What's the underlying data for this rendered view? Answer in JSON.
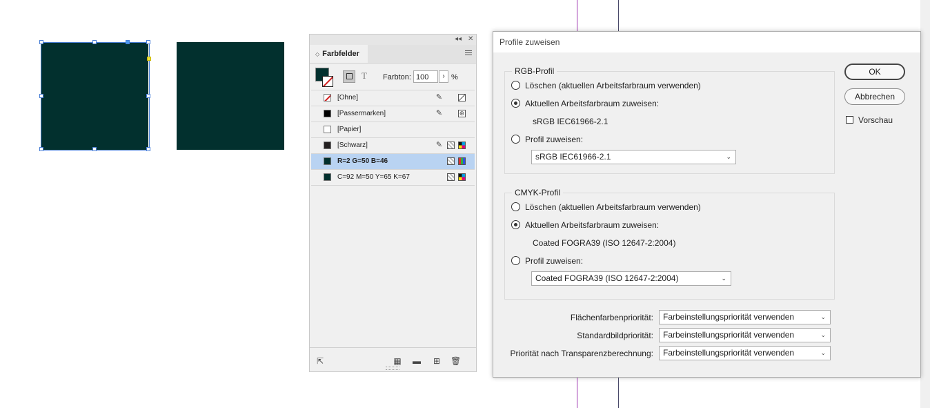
{
  "colors": {
    "deep_green": "#02302e",
    "guide_purple": "#9b2fae",
    "guide_dark": "#4a4a6a",
    "selection_blue": "#4a7fd6"
  },
  "swatches_panel": {
    "collapse_icon": "double-chevron-left-icon",
    "close_icon": "close-icon",
    "tab_label": "Farbfelder",
    "tint_label": "Farbton:",
    "tint_value": "100",
    "tint_unit": "%",
    "text_mode_glyph": "T",
    "swatches": [
      {
        "name": "[Ohne]",
        "color": "none",
        "icons": [
          "no-edit-icon",
          "box-slash-icon"
        ]
      },
      {
        "name": "[Passermarken]",
        "color": "#000000",
        "icons": [
          "no-edit-icon",
          "registration-icon"
        ]
      },
      {
        "name": "[Papier]",
        "color": "#ffffff",
        "icons": []
      },
      {
        "name": "[Schwarz]",
        "color": "#231f20",
        "icons": [
          "no-edit-icon",
          "process-icon",
          "cmyk-icon"
        ]
      },
      {
        "name": "R=2 G=50 B=46",
        "color": "#02302e",
        "icons": [
          "process-icon",
          "rgb-icon"
        ],
        "selected": true
      },
      {
        "name": "C=92 M=50 Y=65 K=67",
        "color": "#02302e",
        "icons": [
          "process-icon",
          "cmyk-icon"
        ]
      }
    ]
  },
  "dialog": {
    "title": "Profile zuweisen",
    "ok_label": "OK",
    "cancel_label": "Abbrechen",
    "preview_label": "Vorschau",
    "preview_checked": false,
    "rgb": {
      "title": "RGB-Profil",
      "option_discard": "Löschen (aktuellen Arbeitsfarbraum verwenden)",
      "option_current": "Aktuellen Arbeitsfarbraum zuweisen:",
      "current_profile": "sRGB IEC61966-2.1",
      "option_assign": "Profil zuweisen:",
      "assign_value": "sRGB IEC61966-2.1",
      "selected": "current"
    },
    "cmyk": {
      "title": "CMYK-Profil",
      "option_discard": "Löschen (aktuellen Arbeitsfarbraum verwenden)",
      "option_current": "Aktuellen Arbeitsfarbraum zuweisen:",
      "current_profile": "Coated FOGRA39 (ISO 12647-2:2004)",
      "option_assign": "Profil zuweisen:",
      "assign_value": "Coated FOGRA39 (ISO 12647-2:2004)",
      "selected": "current"
    },
    "intents": [
      {
        "label": "Flächenfarbenpriorität:",
        "value": "Farbeinstellungspriorität verwenden"
      },
      {
        "label": "Standardbildpriorität:",
        "value": "Farbeinstellungspriorität verwenden"
      },
      {
        "label": "Priorität nach Transparenzberechnung:",
        "value": "Farbeinstellungspriorität verwenden"
      }
    ]
  }
}
